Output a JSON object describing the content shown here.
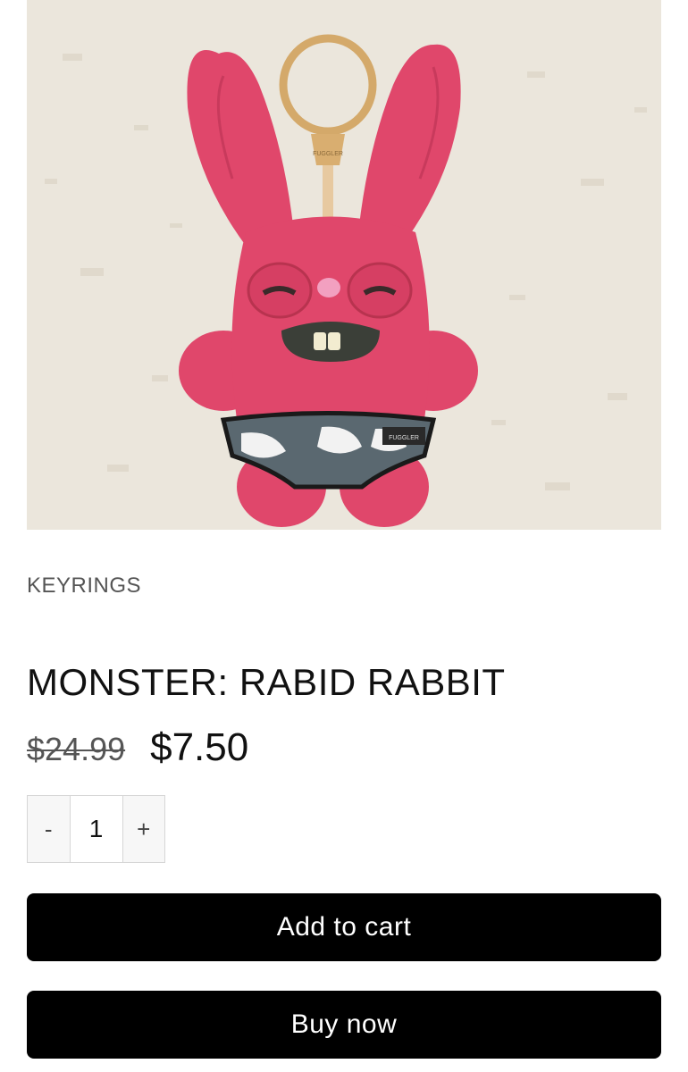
{
  "product": {
    "category": "KEYRINGS",
    "title": "MONSTER: RABID RABBIT",
    "price_compare": "$24.99",
    "price_sale": "$7.50",
    "image_brand_tag": "FUGGLER",
    "image_underwear_tag": "FUGGLER"
  },
  "quantity": {
    "decrement_label": "-",
    "value": "1",
    "increment_label": "+"
  },
  "actions": {
    "add_to_cart_label": "Add to cart",
    "buy_now_label": "Buy now"
  },
  "colors": {
    "image_background": "#ebe6dc",
    "plush_pink": "#e0476b",
    "button_bg": "#000000",
    "button_text": "#ffffff"
  }
}
